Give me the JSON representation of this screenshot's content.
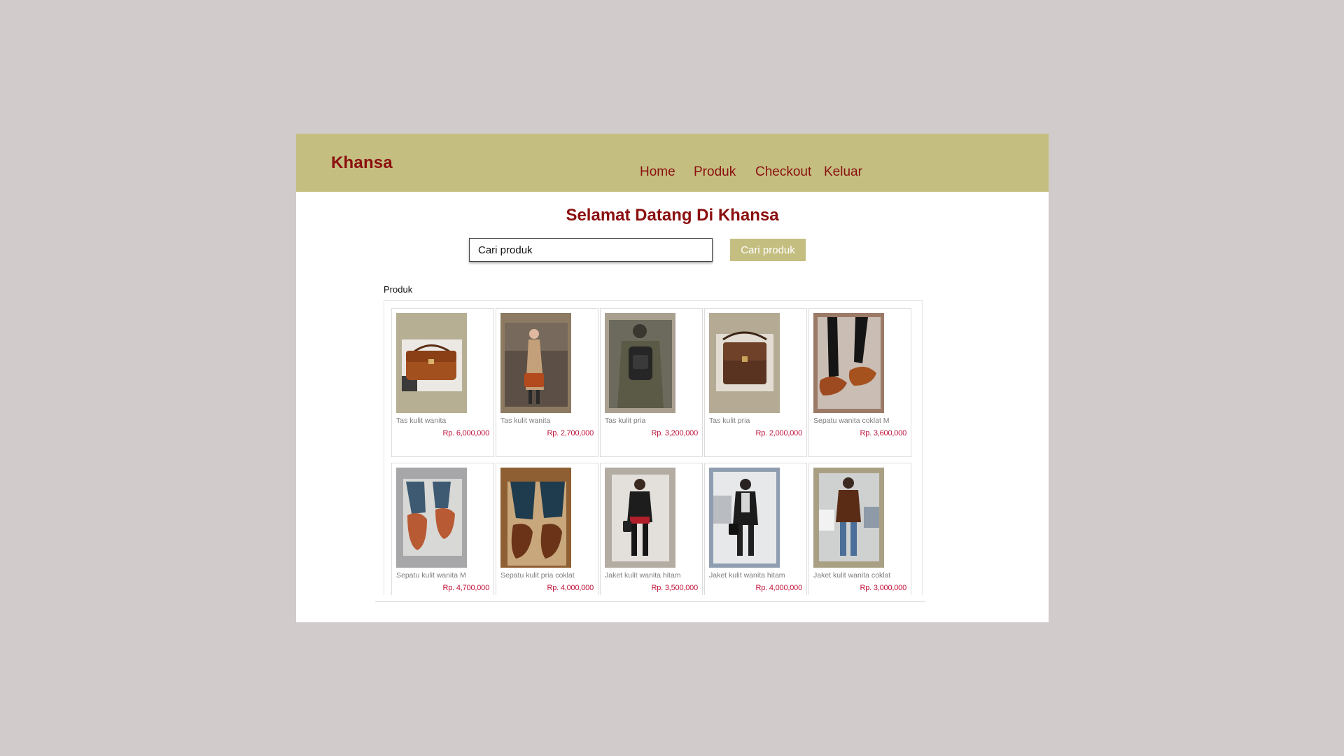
{
  "header": {
    "brand": "Khansa",
    "nav": [
      "Home",
      "Produk",
      "Checkout",
      "Keluar"
    ]
  },
  "welcome_title": "Selamat Datang Di Khansa",
  "search": {
    "placeholder": "Cari produk",
    "button_label": "Cari produk"
  },
  "section_label": "Produk",
  "products": [
    {
      "name": "Tas kulit wanita",
      "price": "Rp. 6,000,000",
      "image": "brown-leather-handbag-image"
    },
    {
      "name": "Tas kulit wanita",
      "price": "Rp. 2,700,000",
      "image": "woman-with-leather-bag-image"
    },
    {
      "name": "Tas kulit pria",
      "price": "Rp. 3,200,000",
      "image": "leather-backpack-image"
    },
    {
      "name": "Tas kulit pria",
      "price": "Rp. 2,000,000",
      "image": "brown-messenger-bag-image"
    },
    {
      "name": "Sepatu wanita coklat M",
      "price": "Rp. 3,600,000",
      "image": "brown-womens-shoes-image"
    },
    {
      "name": "Sepatu kulit wanita M",
      "price": "Rp. 4,700,000",
      "image": "brown-loafers-image"
    },
    {
      "name": "Sepatu kulit pria coklat",
      "price": "Rp. 4,000,000",
      "image": "mens-brown-shoes-image"
    },
    {
      "name": "Jaket kulit wanita hitam",
      "price": "Rp. 3,500,000",
      "image": "black-leather-jacket-woman-image"
    },
    {
      "name": "Jaket kulit wanita hitam",
      "price": "Rp. 4,000,000",
      "image": "black-leather-jacket-street-image"
    },
    {
      "name": "Jaket kulit wanita coklat",
      "price": "Rp. 3,000,000",
      "image": "brown-leather-jacket-woman-image"
    }
  ],
  "colors": {
    "page_bg": "#d1cbcb",
    "header_bg": "#c4bf81",
    "brand_text": "#8b0f0f",
    "price_text": "#c0123a",
    "button_bg": "#c4bf81"
  }
}
